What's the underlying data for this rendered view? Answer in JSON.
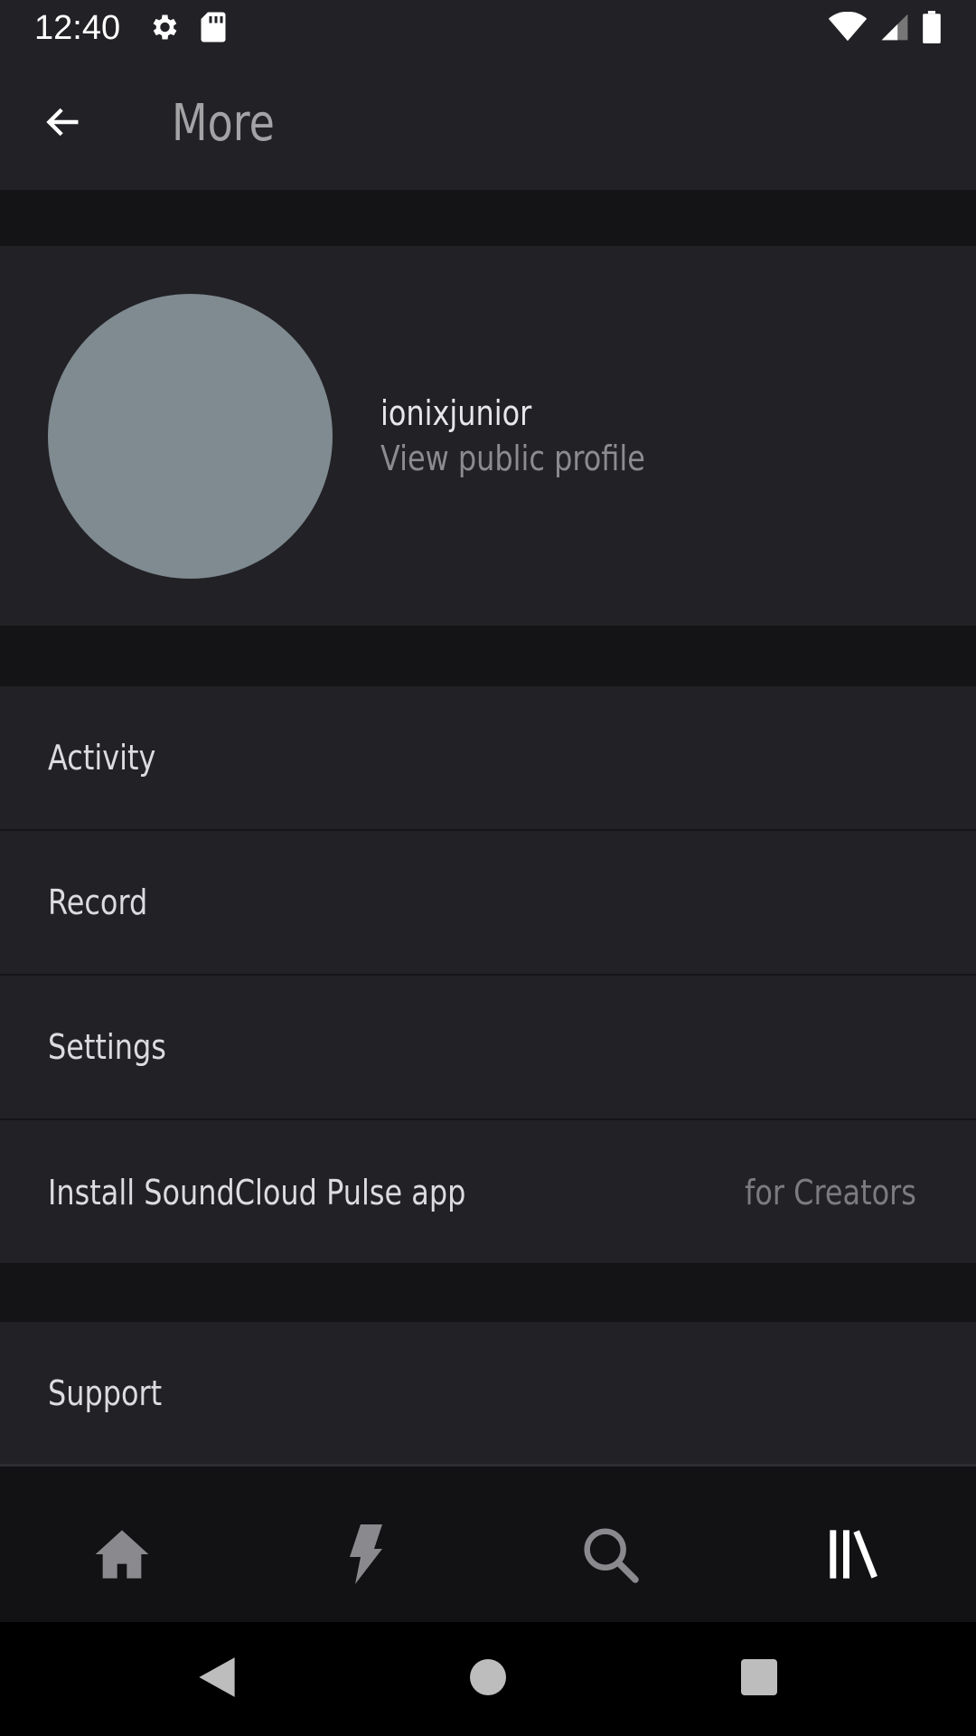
{
  "status_bar": {
    "time": "12:40",
    "left_icons": [
      "settings-icon",
      "sd-card-icon"
    ],
    "right_icons": [
      "wifi-icon",
      "cell-signal-icon",
      "battery-icon"
    ]
  },
  "app_bar": {
    "title": "More",
    "back_icon": "arrow-left-icon"
  },
  "profile": {
    "username": "ionixjunior",
    "link_label": "View public profile",
    "avatar_color": "#7f8a91"
  },
  "menu": {
    "items": [
      {
        "label": "Activity"
      },
      {
        "label": "Record"
      },
      {
        "label": "Settings"
      },
      {
        "label": "Install SoundCloud Pulse app",
        "secondary": "for Creators"
      }
    ],
    "support_label": "Support"
  },
  "bottom_nav": {
    "tabs": [
      {
        "icon": "home-icon",
        "active": false
      },
      {
        "icon": "lightning-icon",
        "active": false
      },
      {
        "icon": "search-icon",
        "active": false
      },
      {
        "icon": "library-icon",
        "active": true
      }
    ]
  },
  "system_nav": [
    "back-triangle-icon",
    "home-circle-icon",
    "recents-square-icon"
  ],
  "colors": {
    "surface": "#222125",
    "background": "#121214",
    "text_primary": "#dcdcdf",
    "text_secondary": "#8c8c90"
  }
}
